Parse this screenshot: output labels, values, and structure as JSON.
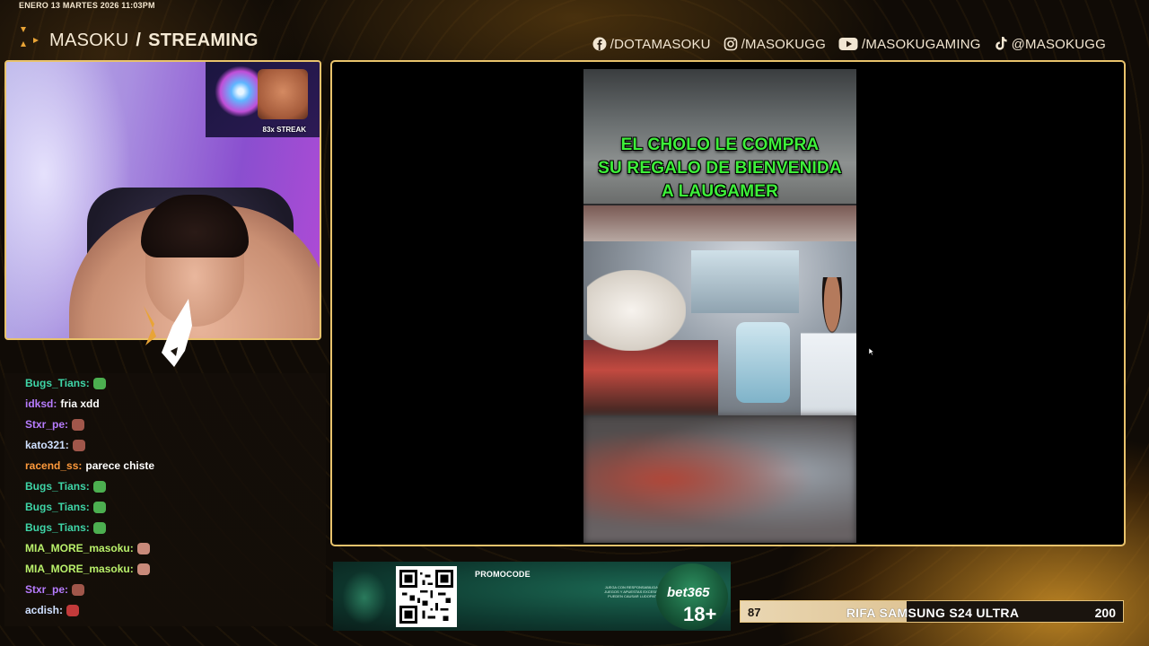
{
  "header": {
    "datetime": "ENERO 13 MARTES 2026 11:03PM",
    "brand_light": "MASOKU",
    "brand_slash": "/",
    "brand_bold": "STREAMING"
  },
  "socials": [
    {
      "icon": "facebook-icon",
      "handle": "/DOTAMASOKU"
    },
    {
      "icon": "instagram-icon",
      "handle": "/MASOKUGG"
    },
    {
      "icon": "youtube-icon",
      "handle": "/MASOKUGAMING"
    },
    {
      "icon": "tiktok-icon",
      "handle": "@MASOKUGG"
    }
  ],
  "webcam": {
    "streak_label": "83x STREAK"
  },
  "chat": [
    {
      "user": "Bugs_Tians:",
      "color": "#3fd6a8",
      "msg": "",
      "emote": "#4caf50"
    },
    {
      "user": "idksd:",
      "color": "#b77cff",
      "msg": "fria xdd",
      "emote": ""
    },
    {
      "user": "Stxr_pe:",
      "color": "#b77cff",
      "msg": "",
      "emote": "#a0564a"
    },
    {
      "user": "kato321:",
      "color": "#cfe0ff",
      "msg": "",
      "emote": "#a0564a"
    },
    {
      "user": "racend_ss:",
      "color": "#ff9a3c",
      "msg": "parece chiste",
      "emote": ""
    },
    {
      "user": "Bugs_Tians:",
      "color": "#3fd6a8",
      "msg": "",
      "emote": "#4caf50"
    },
    {
      "user": "Bugs_Tians:",
      "color": "#3fd6a8",
      "msg": "",
      "emote": "#4caf50"
    },
    {
      "user": "Bugs_Tians:",
      "color": "#3fd6a8",
      "msg": "",
      "emote": "#4caf50"
    },
    {
      "user": "MIA_MORE_masoku:",
      "color": "#b9f06b",
      "msg": "",
      "emote": "#c98a7a"
    },
    {
      "user": "MIA_MORE_masoku:",
      "color": "#b9f06b",
      "msg": "",
      "emote": "#c98a7a"
    },
    {
      "user": "Stxr_pe:",
      "color": "#b77cff",
      "msg": "",
      "emote": "#a0564a"
    },
    {
      "user": "acdish:",
      "color": "#cfe0ff",
      "msg": "",
      "emote": "#c23a3a"
    }
  ],
  "video": {
    "caption_lines": [
      "EL CHOLO LE COMPRA",
      "SU REGALO DE BIENVENIDA",
      "A LAUGAMER"
    ]
  },
  "ad": {
    "promocode_label": "PROMOCODE",
    "brand": "bet365",
    "age": "18+",
    "fineprint": "JUEGA CON RESPONSABILIDAD · JUEGOS Y APUESTAS EXCESIVAS PUEDEN CAUSAR LUDOPATÍA"
  },
  "raffle": {
    "current": "87",
    "goal": "200",
    "progress_fraction": 0.435,
    "title": "RIFA SAMSUNG S24 ULTRA"
  },
  "colors": {
    "accent_gold": "#e9c36c",
    "caption_green": "#3ef03a"
  }
}
